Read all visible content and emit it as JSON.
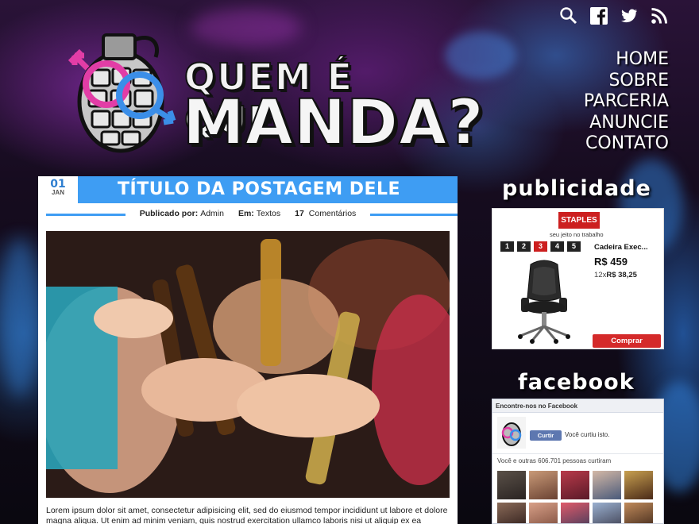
{
  "header": {
    "logo_line1": "QUEM É QUE",
    "logo_line2": "MANDA?",
    "social_icons": [
      {
        "name": "search-icon"
      },
      {
        "name": "facebook-icon"
      },
      {
        "name": "twitter-icon"
      },
      {
        "name": "rss-icon"
      }
    ],
    "nav": [
      "HOME",
      "SOBRE",
      "PARCERIA",
      "ANUNCIE",
      "CONTATO"
    ]
  },
  "post": {
    "date_day": "01",
    "date_month": "JAN",
    "title": "TÍTULO DA POSTAGEM DELE",
    "author_label": "Publicado por:",
    "author": "Admin",
    "category_label": "Em:",
    "category": "Textos",
    "comments_count": "17",
    "comments_label": "Comentários",
    "excerpt": "Lorem ipsum dolor sit amet, consectetur adipisicing elit, sed do eiusmod tempor incididunt ut labore et dolore magna aliqua. Ut enim ad minim veniam, quis nostrud exercitation ullamco laboris nisi ut aliquip ex ea commodo"
  },
  "sidebar": {
    "ad_title": "publicidade",
    "ad": {
      "brand": "STAPLES",
      "tagline": "seu jeito no trabalho",
      "pages": [
        "1",
        "2",
        "3",
        "4",
        "5"
      ],
      "active_page": "3",
      "product": "Cadeira Exec...",
      "price": "R$ 459",
      "installment_prefix": "12x",
      "installment_value": "R$ 38,25",
      "buy_label": "Comprar"
    },
    "fb_title": "facebook",
    "fb": {
      "header": "Encontre-nos no Facebook",
      "like_label": "Curtir",
      "liked_text": "Você curtiu isto.",
      "count_text": "Você e outras 606.701 pessoas curtiram"
    }
  },
  "colors": {
    "accent_blue": "#3e9df3",
    "staples_red": "#cc1f1f",
    "fb_blue": "#5d77b0",
    "logo_pink": "#e23da6",
    "logo_blue": "#3b8ee8"
  }
}
